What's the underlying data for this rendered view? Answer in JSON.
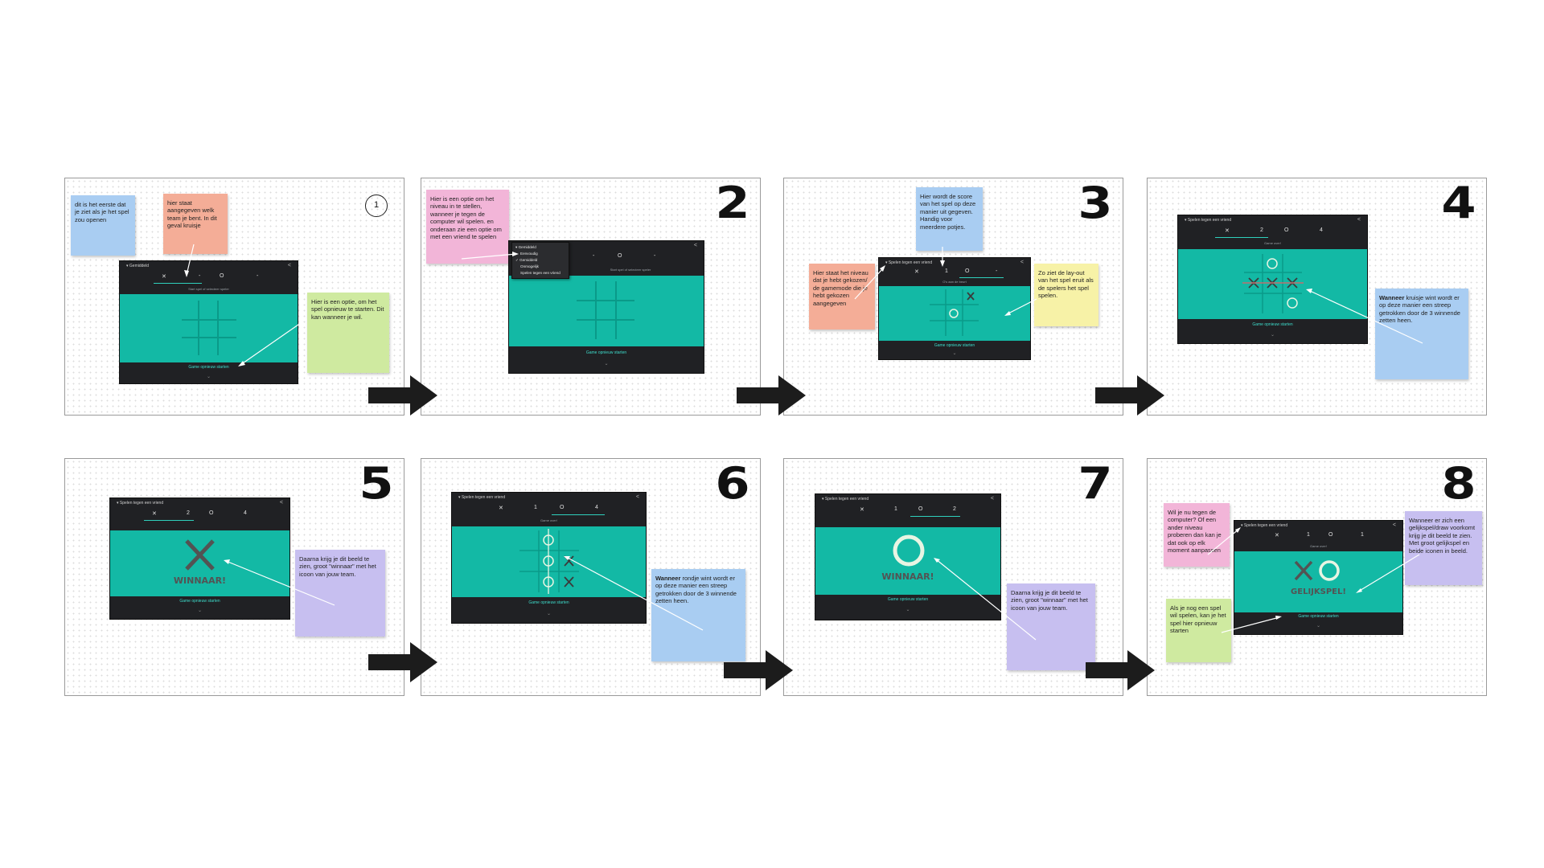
{
  "panels": {
    "p1": {
      "num": "1",
      "note_blue": "dit is het eerste dat je ziet als je het spel zou openen",
      "note_salmon": "hier staat aangegeven welk team je bent. In dit geval kruisje",
      "note_green": "Hier is een optie, om het spel opnieuw te starten. Dit kan wanneer je wil.",
      "screen_title": "Gemiddeld",
      "score_x": "✕",
      "score_x_val": "-",
      "score_o": "O",
      "score_o_val": "-",
      "sub": "Start spel of selecteer speler",
      "restart": "Game opnieuw starten"
    },
    "p2": {
      "num": "2",
      "note_pink": "Hier is een optie om het niveau in te stellen, wanneer je tegen de computer wil spelen. en onderaan zie een optie om met een vriend te spelen",
      "menu": [
        "Gemiddeld",
        "Eenvoudig",
        "Gemiddeld",
        "Onmogelijk",
        "Spelen tegen een vriend"
      ],
      "score_x_val": "-",
      "score_o": "O",
      "score_o_val": "-",
      "sub": "Start spel of selecteer speler",
      "restart": "Game opnieuw starten"
    },
    "p3": {
      "num": "3",
      "note_blue": "Hier wordt de score van het spel op deze manier uit gegeven. Handig voor meerdere potjes.",
      "note_salmon": "Hier staat het niveau dat je hebt gekozen/ de gamemode die je hebt gekozen aangegeven",
      "note_yellow": "Zo ziet de lay-out van het spel eruit als de spelers het spel spelen.",
      "screen_title": "Spelen tegen een vriend",
      "score_x": "✕",
      "score_x_val": "1",
      "score_o": "O",
      "score_o_val": "-",
      "sub": "O's aan de beurt",
      "restart": "Game opnieuw starten"
    },
    "p4": {
      "num": "4",
      "note_bold": "Wanneer",
      "note_rest": " kruisje wint wordt er op deze manier een streep getrokken door de 3 winnende zetten heen.",
      "screen_title": "Spelen tegen een vriend",
      "score_x": "✕",
      "score_x_val": "2",
      "score_o": "O",
      "score_o_val": "4",
      "sub": "Game over!",
      "restart": "Game opnieuw starten"
    },
    "p5": {
      "num": "5",
      "note_purple": "Daarna krijg je dit beeld te zien, groot \"winnaar\" met het icoon van jouw team.",
      "screen_title": "Spelen tegen een vriend",
      "score_x": "✕",
      "score_x_val": "2",
      "score_o": "O",
      "score_o_val": "4",
      "winner": "WINNAAR!",
      "restart": "Game opnieuw starten"
    },
    "p6": {
      "num": "6",
      "note_bold": "Wanneer",
      "note_rest": " rondje wint wordt er op deze manier een streep getrokken door de 3 winnende zetten heen.",
      "screen_title": "Spelen tegen een vriend",
      "score_x": "✕",
      "score_x_val": "1",
      "score_o": "O",
      "score_o_val": "4",
      "sub": "Game over!",
      "restart": "Game opnieuw starten"
    },
    "p7": {
      "num": "7",
      "note_purple": "Daarna krijg je dit beeld te zien, groot \"winnaar\" met het icoon van jouw team.",
      "screen_title": "Spelen tegen een vriend",
      "score_x": "✕",
      "score_x_val": "1",
      "score_o": "O",
      "score_o_val": "2",
      "winner": "WINNAAR!",
      "restart": "Game opnieuw starten"
    },
    "p8": {
      "num": "8",
      "note_pink": "Wil je nu tegen de computer? Of een ander niveau proberen dan kan je dat ook op elk moment aanpassen",
      "note_purple": "Wanneer er zich een gelijkspel/draw voorkomt krijg je dit beeld te zien. Met groot gelijkspel en beide iconen in beeld.",
      "note_green": "Als je nog een spel wil spelen, kan je het spel hier opnieuw starten",
      "screen_title": "Spelen tegen een vriend",
      "score_x": "✕",
      "score_x_val": "1",
      "score_o": "O",
      "score_o_val": "1",
      "sub": "Game over!",
      "draw": "GELIJKSPEL!",
      "restart": "Game opnieuw starten"
    }
  },
  "colors": {
    "board": "#13b9a5",
    "screen": "#202124",
    "accent": "#3ddccb"
  }
}
